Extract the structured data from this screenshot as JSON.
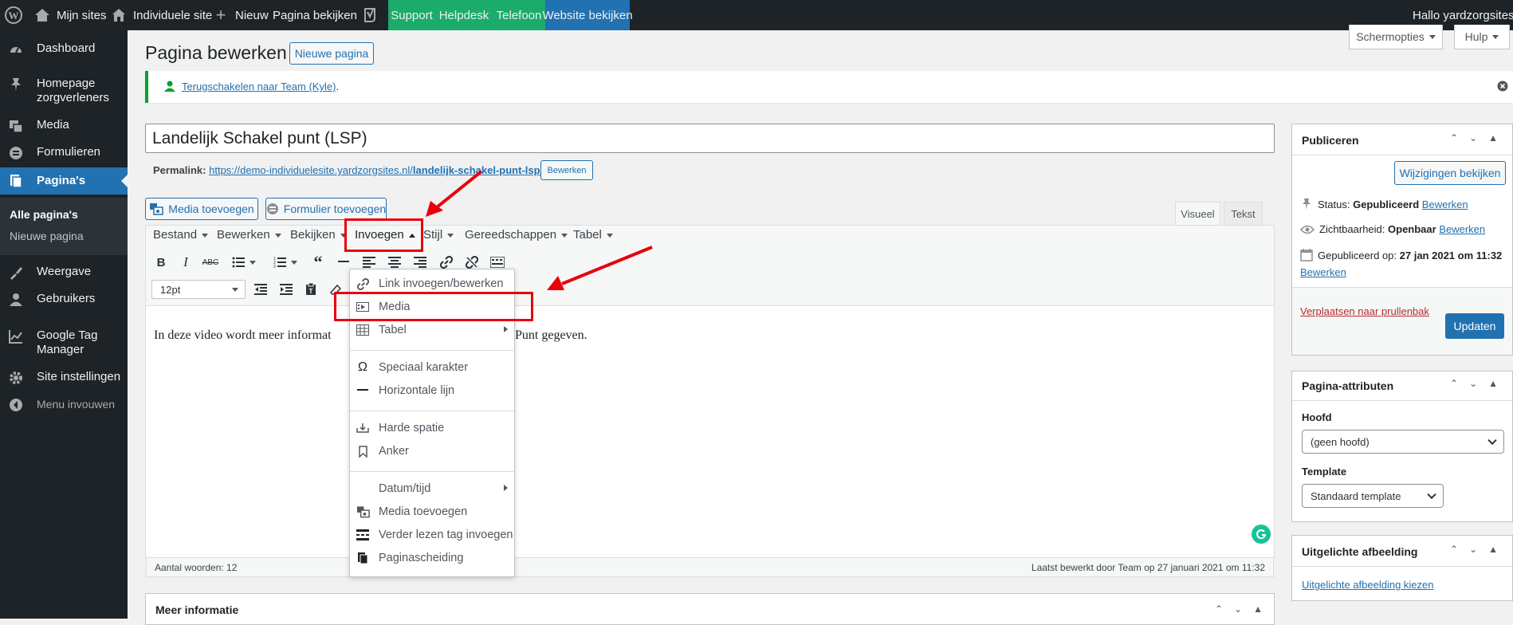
{
  "adminbar": {
    "my_sites": "Mijn sites",
    "site": "Individuele site",
    "new": "Nieuw",
    "view_page": "Pagina bekijken",
    "support": "Support",
    "helpdesk": "Helpdesk",
    "telefoon": "Telefoon",
    "view_website": "Website bekijken",
    "greeting": "Hallo yardzorgsites"
  },
  "sidebar": {
    "items": [
      {
        "label": "Dashboard",
        "icon": "dashboard-icon"
      },
      {
        "label": "Homepage zorgverleners",
        "icon": "pin-icon"
      },
      {
        "label": "Media",
        "icon": "media-icon"
      },
      {
        "label": "Formulieren",
        "icon": "forms-icon"
      },
      {
        "label": "Pagina's",
        "icon": "pages-icon"
      },
      {
        "label": "Weergave",
        "icon": "appearance-icon"
      },
      {
        "label": "Gebruikers",
        "icon": "users-icon"
      },
      {
        "label": "Google Tag Manager",
        "icon": "chart-icon"
      },
      {
        "label": "Site instellingen",
        "icon": "gear-icon"
      },
      {
        "label": "Menu invouwen",
        "icon": "collapse-icon"
      }
    ],
    "submenu": [
      "Alle pagina's",
      "Nieuwe pagina"
    ]
  },
  "screen_options": "Schermopties",
  "help": "Hulp",
  "page_title": "Pagina bewerken",
  "new_page_button": "Nieuwe pagina",
  "notice": {
    "link": "Terugschakelen naar Team (Kyle)",
    "suffix": "."
  },
  "post_title": "Landelijk Schakel punt (LSP)",
  "permalink": {
    "label": "Permalink:",
    "url_prefix": "https://demo-individuelesite.yardzorgsites.nl/",
    "slug": "landelijk-schakel-punt-lsp",
    "url_suffix": "/",
    "edit": "Bewerken"
  },
  "media_button": "Media toevoegen",
  "form_button": "Formulier toevoegen",
  "tabs": {
    "visual": "Visueel",
    "text": "Tekst"
  },
  "menubar": [
    "Bestand",
    "Bewerken",
    "Bekijken",
    "Invoegen",
    "Stijl",
    "Gereedschappen",
    "Tabel"
  ],
  "fontsize": "12pt",
  "content_start": "In deze video wordt meer informat",
  "content_end": "Punt gegeven.",
  "dropdown": [
    {
      "label": "Link invoegen/bewerken",
      "icon": "link-icon"
    },
    {
      "label": "Media",
      "icon": "media-icon"
    },
    {
      "label": "Tabel",
      "icon": "table-icon",
      "submenu": true
    },
    {
      "label": "Speciaal karakter",
      "icon": "omega-icon"
    },
    {
      "label": "Horizontale lijn",
      "icon": "horizontal-line-icon"
    },
    {
      "label": "Harde spatie",
      "icon": "nonbreaking-icon"
    },
    {
      "label": "Anker",
      "icon": "bookmark-icon"
    },
    {
      "label": "Datum/tijd",
      "icon": "",
      "submenu": true
    },
    {
      "label": "Media toevoegen",
      "icon": "add-media-icon"
    },
    {
      "label": "Verder lezen tag invoegen",
      "icon": "more-tag-icon"
    },
    {
      "label": "Paginascheiding",
      "icon": "page-break-icon"
    }
  ],
  "status_bar": {
    "words": "Aantal woorden: 12",
    "last_edited": "Laatst bewerkt door Team op 27 januari 2021 om 11:32"
  },
  "more_info": "Meer informatie",
  "publish": {
    "title": "Publiceren",
    "preview_button": "Wijzigingen bekijken",
    "status_label": "Status:",
    "status_value": "Gepubliceerd",
    "visibility_label": "Zichtbaarheid:",
    "visibility_value": "Openbaar",
    "published_label": "Gepubliceerd op:",
    "published_value": "27 jan 2021 om 11:32",
    "edit": "Bewerken",
    "trash": "Verplaatsen naar prullenbak",
    "update_button": "Updaten"
  },
  "page_attributes": {
    "title": "Pagina-attributen",
    "parent_label": "Hoofd",
    "parent_value": "(geen hoofd)",
    "template_label": "Template",
    "template_value": "Standaard template"
  },
  "featured_image": {
    "title": "Uitgelichte afbeelding",
    "link": "Uitgelichte afbeelding kiezen"
  },
  "colors": {
    "primary": "#2271b1",
    "admin_dark": "#1d2327",
    "highlight_red": "#e8000b",
    "green": "#1bab6b"
  }
}
